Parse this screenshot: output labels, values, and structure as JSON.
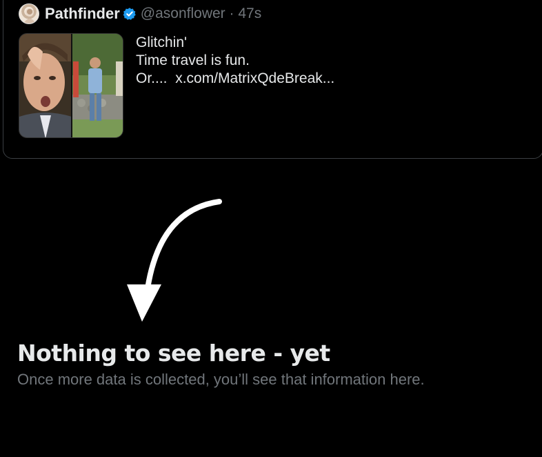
{
  "tweet": {
    "author_name": "Pathfinder",
    "handle_and_time": "@asonflower · 47s",
    "text_line_1": "Glitchin'",
    "text_line_2": "Time travel is fun.",
    "text_line_3_prefix": "Or....",
    "text_line_3_link": "x.com/MatrixQdeBreak...",
    "verified_color": "#1d9bf0"
  },
  "empty_state": {
    "title": "Nothing to see here - yet",
    "subtitle": "Once more data is collected, you’ll see that information here."
  },
  "icons": {
    "avatar": "avatar-icon",
    "verified": "verified-badge-icon",
    "arrow": "curved-arrow-down-icon"
  },
  "colors": {
    "background": "#000000",
    "primary_text": "#e7e9ea",
    "secondary_text": "#71767b",
    "card_border": "#3c4044"
  }
}
